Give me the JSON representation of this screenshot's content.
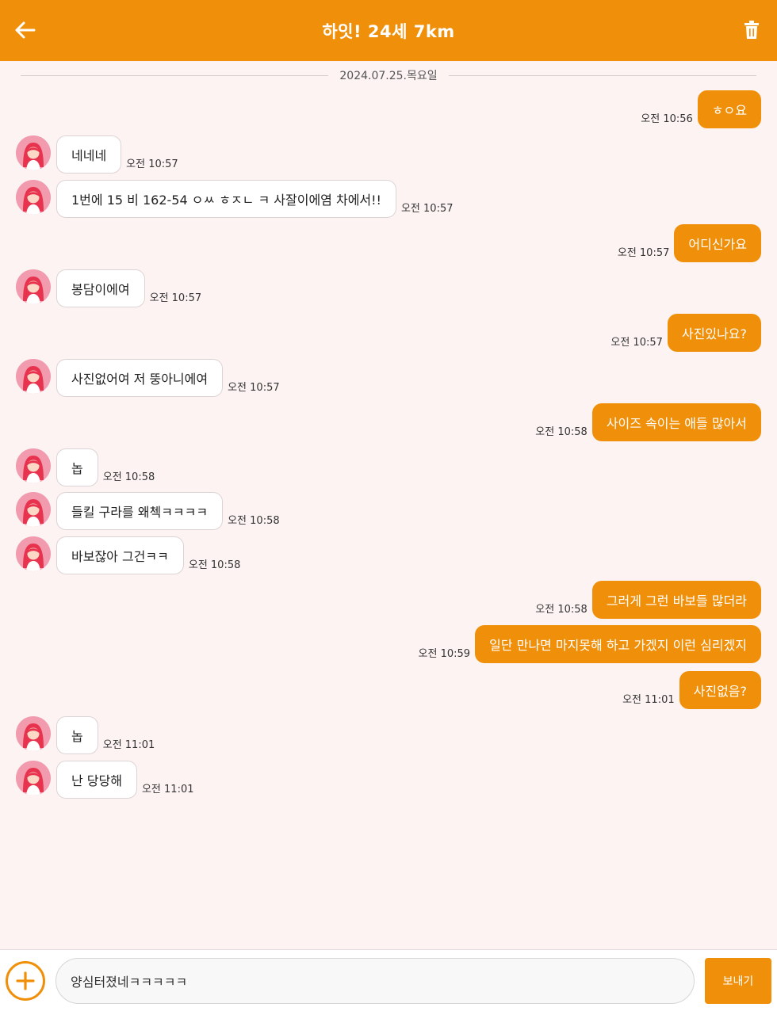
{
  "header": {
    "title": "하잇! 24세 7km",
    "back_icon": "back-arrow-icon",
    "trash_icon": "trash-icon",
    "color": "#f0900a"
  },
  "date_divider": "2024.07.25.목요일",
  "messages": [
    {
      "side": "right",
      "text": "ㅎㅇ요",
      "time": "오전 10:56"
    },
    {
      "side": "left",
      "text": "네네네",
      "time": "오전 10:57"
    },
    {
      "side": "left",
      "text": "1번에 15 비 162-54 ㅇㅆ ㅎㅈㄴ ㅋ 사잘이에염 차에서!!",
      "time": "오전 10:57"
    },
    {
      "side": "right",
      "text": "어디신가요",
      "time": "오전 10:57"
    },
    {
      "side": "left",
      "text": "봉담이에여",
      "time": "오전 10:57"
    },
    {
      "side": "right",
      "text": "사진있나요?",
      "time": "오전 10:57"
    },
    {
      "side": "left",
      "text": "사진없어여 저 뚱아니에여",
      "time": "오전 10:57"
    },
    {
      "side": "right",
      "text": "사이즈 속이는 애들 많아서",
      "time": "오전 10:58"
    },
    {
      "side": "left",
      "text": "놉",
      "time": "오전 10:58"
    },
    {
      "side": "left",
      "text": "들킬 구라를 왜첵ㅋㅋㅋㅋ",
      "time": "오전 10:58"
    },
    {
      "side": "left",
      "text": "바보잖아 그건ㅋㅋ",
      "time": "오전 10:58"
    },
    {
      "side": "right",
      "text": "그러게 그런 바보들 많더라",
      "time": "오전 10:58"
    },
    {
      "side": "right",
      "text": "일단 만나면 마지못해 하고 가겠지 이런 심리겠지",
      "time": "오전 10:59"
    },
    {
      "side": "right",
      "text": "사진없음?",
      "time": "오전 11:01"
    },
    {
      "side": "left",
      "text": "놉",
      "time": "오전 11:01"
    },
    {
      "side": "left",
      "text": "난 당당해",
      "time": "오전 11:01"
    }
  ],
  "input": {
    "value": "양심터졌네ㅋㅋㅋㅋㅋ",
    "plus_icon": "plus-icon",
    "send_label": "보내기"
  }
}
